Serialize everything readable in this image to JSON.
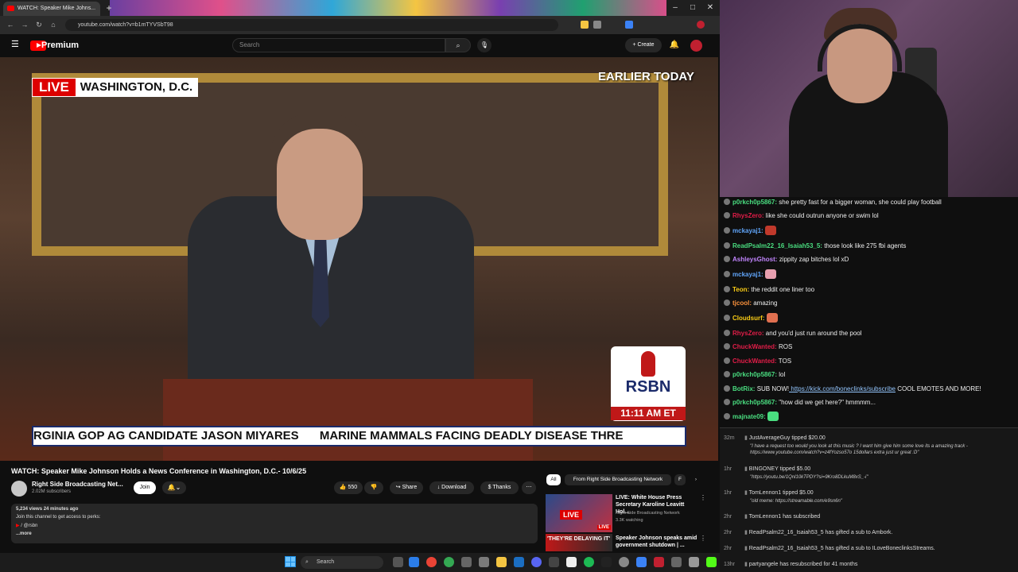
{
  "browser": {
    "tab_title": "WATCH: Speaker Mike Johns...",
    "url": "youtube.com/watch?v=b1mTYVSbT98"
  },
  "youtube": {
    "brand": "Premium",
    "search_placeholder": "Search",
    "create_label": "+ Create"
  },
  "video": {
    "live_label": "LIVE",
    "location": "WASHINGTON, D.C.",
    "earlier": "EARLIER TODAY",
    "network_logo": "RSBN",
    "clock": "11:11 AM ET",
    "ticker": [
      "RGINIA GOP AG CANDIDATE JASON MIYARES",
      "MARINE MAMMALS FACING DEADLY DISEASE THRE"
    ],
    "title": "WATCH: Speaker Mike Johnson Holds a News Conference in Washington, D.C.- 10/6/25",
    "channel": "Right Side Broadcasting Net...",
    "subscribers": "2.02M subscribers",
    "join": "Join",
    "likes": "550",
    "share": "Share",
    "download": "Download",
    "thanks": "Thanks",
    "views": "5,234 views  24 minutes ago",
    "desc_line1": "Join this channel to get access to perks:",
    "desc_line2": "/ @rsbn",
    "desc_more": "...more"
  },
  "sidebar": {
    "chips": [
      "All",
      "From Right Side Broadcasting Network",
      "F"
    ],
    "videos": [
      {
        "title": "LIVE: White House Press Secretary Karoline Leavitt Hol...",
        "channel": "Right Side Broadcasting Network",
        "meta": "3.3K watching",
        "badge": "LIVE",
        "thumb_text": "LIVE"
      },
      {
        "title": "Speaker Johnson speaks amid government shutdown | ...",
        "channel": "",
        "meta": "",
        "badge": "",
        "thumb_text": "'THEY'RE DELAYING IT'"
      }
    ]
  },
  "taskbar": {
    "search": "Search"
  },
  "chat": {
    "messages": [
      {
        "user": "p0rkch0p5867:",
        "text": "she pretty fast for a bigger woman, she could play football",
        "color": "#4ade80"
      },
      {
        "user": "RhysZero:",
        "text": "like she could outrun anyone or swim lol",
        "color": "#e11d48"
      },
      {
        "user": "mckayaj1:",
        "text": "",
        "color": "#60a5fa",
        "emote": "#c0392b"
      },
      {
        "user": "ReadPsalm22_16_Isaiah53_5:",
        "text": "those look like 275 fbi agents",
        "color": "#4ade80"
      },
      {
        "user": "AshleysGhost:",
        "text": "zippity zap bitches lol xD",
        "color": "#c084fc"
      },
      {
        "user": "mckayaj1:",
        "text": "",
        "color": "#60a5fa",
        "emote": "#e8a0b0"
      },
      {
        "user": "Teon:",
        "text": "the reddit one liner too",
        "color": "#facc15"
      },
      {
        "user": "tjcool:",
        "text": "amazing",
        "color": "#fb923c"
      },
      {
        "user": "Cloudsurf:",
        "text": "",
        "color": "#facc15",
        "emote": "#e07050"
      },
      {
        "user": "RhysZero:",
        "text": "and you'd just run around the pool",
        "color": "#e11d48"
      },
      {
        "user": "ChuckWanted:",
        "text": "ROS",
        "color": "#e11d48"
      },
      {
        "user": "ChuckWanted:",
        "text": "TOS",
        "color": "#e11d48"
      },
      {
        "user": "p0rkch0p5867:",
        "text": "lol",
        "color": "#4ade80"
      },
      {
        "user": "BotRix:",
        "text": "SUB NOW!",
        "link": "https://kick.com/boneclinks/subscribe",
        "tail": "COOL EMOTES AND MORE!",
        "color": "#4ade80"
      },
      {
        "user": "p0rkch0p5867:",
        "text": "\"how did we get here?\" hmmmm...",
        "color": "#4ade80"
      },
      {
        "user": "majnate09:",
        "text": "",
        "color": "#4ade80",
        "emote": "#4ade80"
      }
    ],
    "events": [
      {
        "time": "32m",
        "text": "JustAverageGuy tipped $20.00",
        "sub": "\"I have a request too would you look at this music ? I want him give him some love its a amazing track - https://www.youtube.com/watch?v=z4fYozso57o 15dollars extra just ur great :D\""
      },
      {
        "time": "1hr",
        "text": "BINGONEY tipped $5.00",
        "sub": "\"https://youtu.be/1Qnl10kTPDY?si=9Kro8DLkuM8xS_-i\""
      },
      {
        "time": "1hr",
        "text": "TomLennon1 tipped $5.00",
        "sub": "\"old meme: https://streamable.com/e9sn6n\""
      },
      {
        "time": "2hr",
        "text": "TomLennon1 has subscribed",
        "sub": ""
      },
      {
        "time": "2hr",
        "text": "ReadPsalm22_16_Isaiah53_5 has gifted a sub to Ambork.",
        "sub": ""
      },
      {
        "time": "2hr",
        "text": "ReadPsalm22_16_Isaiah53_5 has gifted a sub to ILoveBoneclinksStreams.",
        "sub": ""
      },
      {
        "time": "13hr",
        "text": "partyangele has resubscribed for 41 months",
        "sub": ""
      }
    ]
  }
}
